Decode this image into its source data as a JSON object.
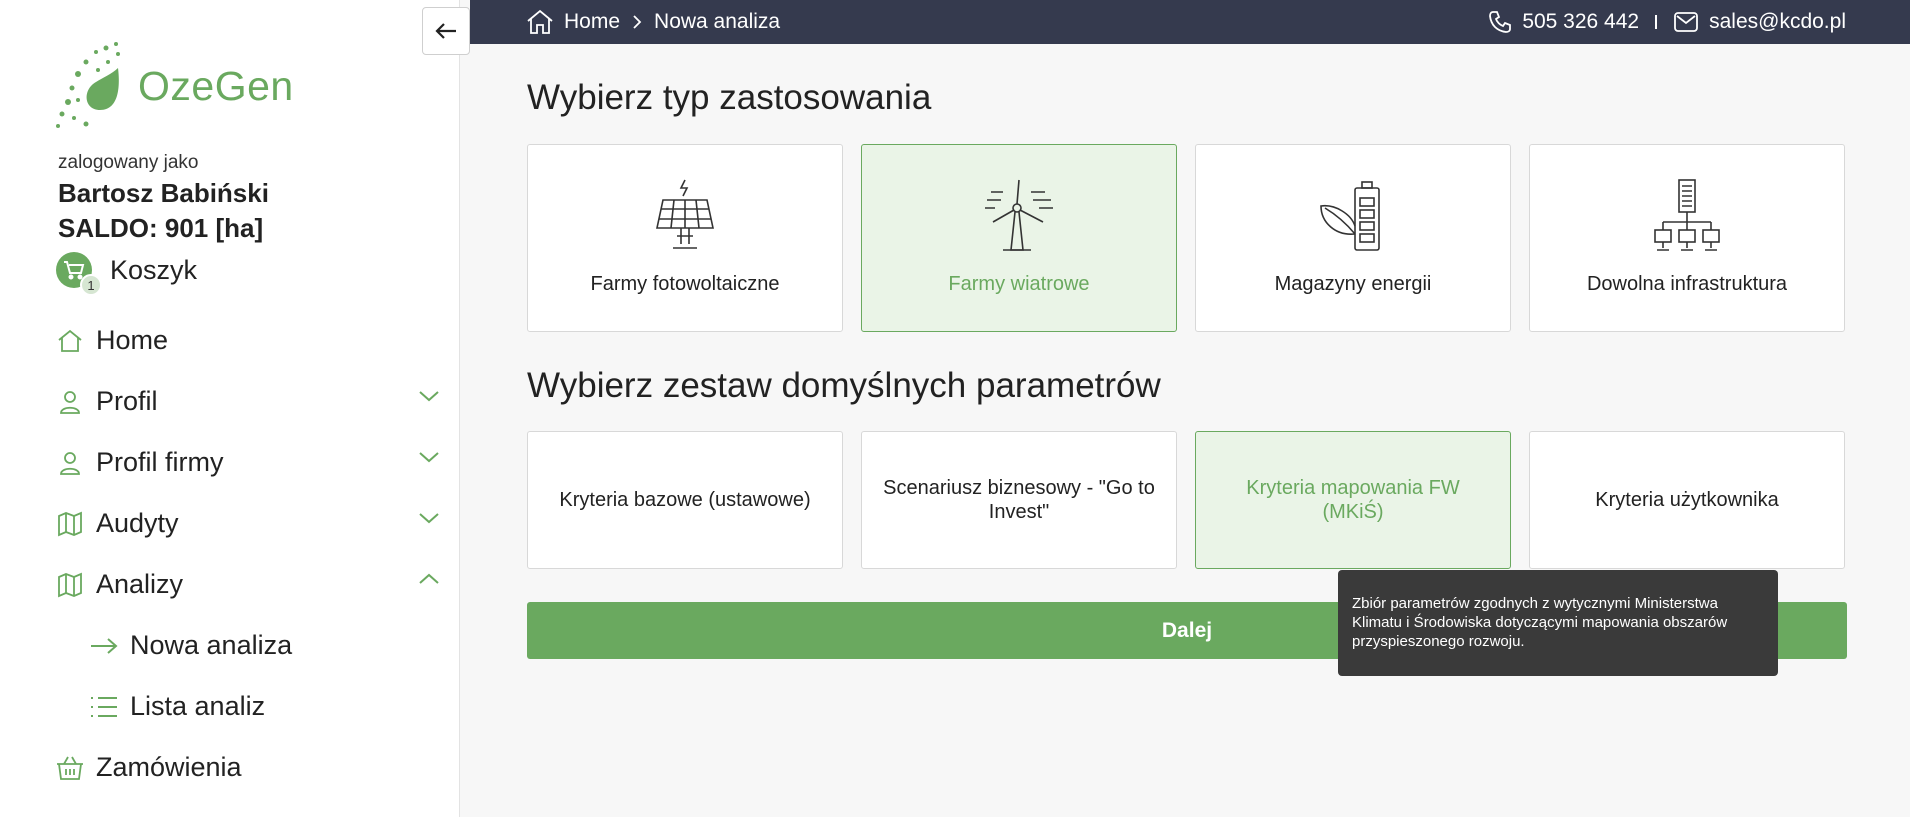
{
  "sidebar": {
    "collapse_icon": "arrow-left-icon",
    "logo_text": "OzeGen",
    "user_caption": "zalogowany jako",
    "user_name": "Bartosz Babiński",
    "saldo": "SALDO: 901 [ha]",
    "cart_label": "Koszyk",
    "cart_count": "1",
    "items": [
      {
        "label": "Home",
        "icon": "home-icon"
      },
      {
        "label": "Profil",
        "icon": "user-icon",
        "chevron": "down"
      },
      {
        "label": "Profil firmy",
        "icon": "user-icon",
        "chevron": "down"
      },
      {
        "label": "Audyty",
        "icon": "map-icon",
        "chevron": "down"
      },
      {
        "label": "Analizy",
        "icon": "map-icon",
        "chevron": "up"
      },
      {
        "label": "Nowa analiza",
        "icon": "arrow-right-icon",
        "sub": true
      },
      {
        "label": "Lista analiz",
        "icon": "list-icon",
        "sub": true
      },
      {
        "label": "Zamówienia",
        "icon": "basket-icon"
      }
    ]
  },
  "topbar": {
    "breadcrumb_home": "Home",
    "breadcrumb_current": "Nowa analiza",
    "phone": "505 326 442",
    "email": "sales@kcdo.pl"
  },
  "main": {
    "title_type": "Wybierz typ zastosowania",
    "title_params": "Wybierz zestaw domyślnych parametrów",
    "types": [
      {
        "label": "Farmy fotowoltaiczne",
        "icon": "solar-panel-icon",
        "selected": false
      },
      {
        "label": "Farmy wiatrowe",
        "icon": "wind-turbine-icon",
        "selected": true
      },
      {
        "label": "Magazyny energii",
        "icon": "battery-leaf-icon",
        "selected": false
      },
      {
        "label": "Dowolna infrastruktura",
        "icon": "infrastructure-icon",
        "selected": false
      }
    ],
    "params": [
      {
        "label": "Kryteria bazowe (ustawowe)",
        "selected": false
      },
      {
        "label": "Scenariusz biznesowy - \"Go to Invest\"",
        "selected": false
      },
      {
        "label": "Kryteria mapowania FW (MKiŚ)",
        "selected": true
      },
      {
        "label": "Kryteria użytkownika",
        "selected": false
      }
    ],
    "next_label": "Dalej",
    "tooltip": "Zbiór parametrów zgodnych z wytycznymi Ministerstwa Klimatu i Środowiska dotyczącymi mapowania obszarów przyspieszonego rozwoju."
  },
  "colors": {
    "accent": "#6aa95f",
    "topbar": "#353a4e",
    "selected_bg": "#eaf4e7",
    "tooltip_bg": "#3a3a3a"
  }
}
